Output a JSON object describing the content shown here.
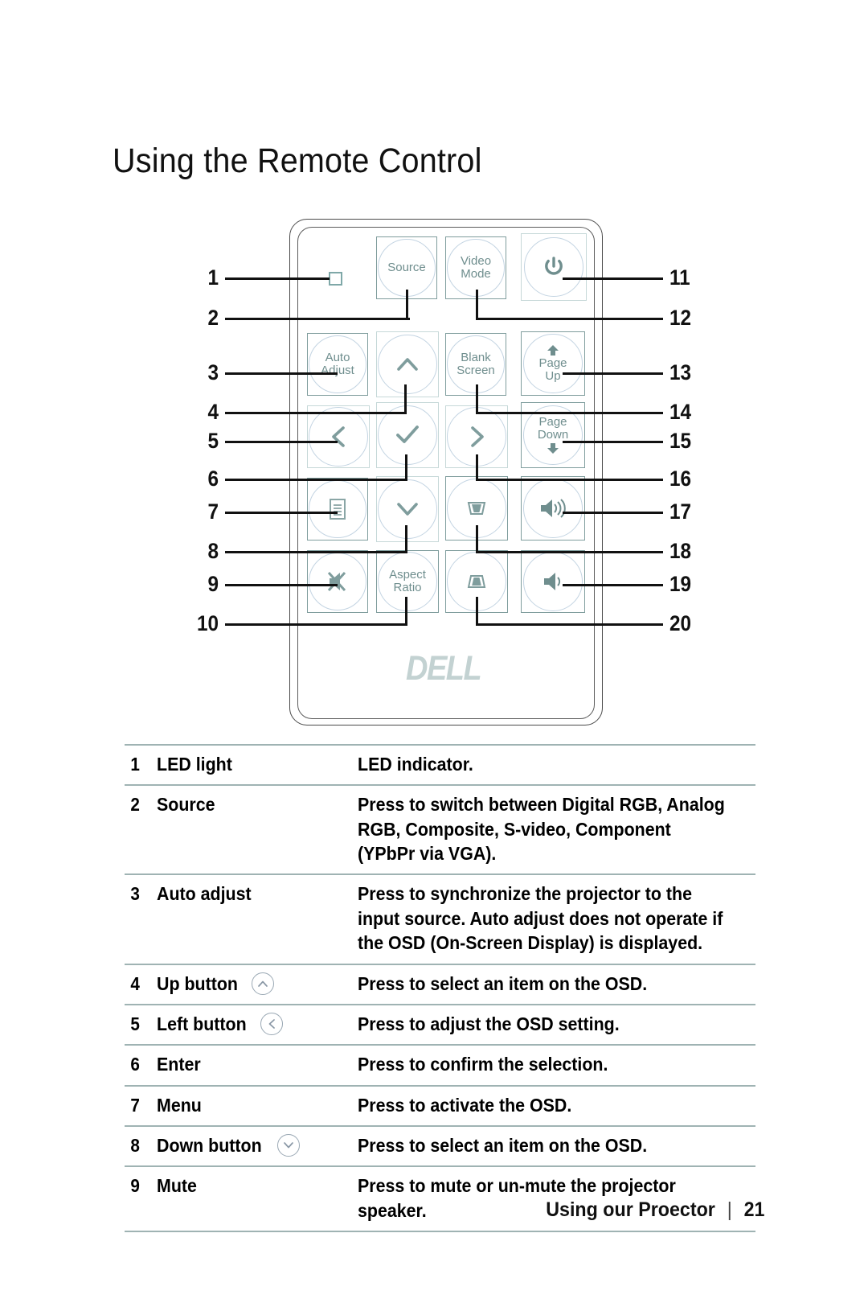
{
  "page_title": "Using the Remote Control",
  "remote": {
    "logo_text": "DELL",
    "led_indicator_name": "led-light",
    "buttons": [
      {
        "id": "source",
        "label": "Source",
        "icon": ""
      },
      {
        "id": "video-mode",
        "label": "Video\nMode",
        "icon": ""
      },
      {
        "id": "power",
        "label": "",
        "icon": "power-icon"
      },
      {
        "id": "auto-adjust",
        "label": "Auto\nAdjust",
        "icon": ""
      },
      {
        "id": "up",
        "label": "",
        "icon": "chevron-up-icon"
      },
      {
        "id": "blank-screen",
        "label": "Blank\nScreen",
        "icon": ""
      },
      {
        "id": "page-up",
        "label": "Page\nUp",
        "icon": "arrow-up-solid-icon"
      },
      {
        "id": "left",
        "label": "",
        "icon": "chevron-left-icon"
      },
      {
        "id": "enter",
        "label": "",
        "icon": "check-icon"
      },
      {
        "id": "right",
        "label": "",
        "icon": "chevron-right-icon"
      },
      {
        "id": "page-down",
        "label": "Page\nDown",
        "icon": "arrow-down-solid-icon"
      },
      {
        "id": "menu",
        "label": "",
        "icon": "menu-list-icon"
      },
      {
        "id": "down",
        "label": "",
        "icon": "chevron-down-icon"
      },
      {
        "id": "keystone-up",
        "label": "",
        "icon": "keystone-up-icon"
      },
      {
        "id": "volume-up",
        "label": "",
        "icon": "volume-up-icon"
      },
      {
        "id": "mute",
        "label": "",
        "icon": "speaker-mute-icon"
      },
      {
        "id": "aspect-ratio",
        "label": "Aspect\nRatio",
        "icon": ""
      },
      {
        "id": "keystone-down",
        "label": "",
        "icon": "keystone-down-icon"
      },
      {
        "id": "volume-down",
        "label": "",
        "icon": "volume-down-icon"
      }
    ],
    "callouts_left": [
      "1",
      "2",
      "3",
      "4",
      "5",
      "6",
      "7",
      "8",
      "9",
      "10"
    ],
    "callouts_right": [
      "11",
      "12",
      "13",
      "14",
      "15",
      "16",
      "17",
      "18",
      "19",
      "20"
    ]
  },
  "table": {
    "rows": [
      {
        "num": "1",
        "name": "LED light",
        "icon": "",
        "desc": "LED indicator."
      },
      {
        "num": "2",
        "name": "Source",
        "icon": "",
        "desc": "Press to switch between Digital RGB, Analog RGB, Composite, S-video, Component (YPbPr via VGA)."
      },
      {
        "num": "3",
        "name": "Auto adjust",
        "icon": "",
        "desc": "Press to synchronize the projector to the input source. Auto adjust does not operate if the OSD (On-Screen Display) is displayed."
      },
      {
        "num": "4",
        "name": "Up button",
        "icon": "chevron-up-icon",
        "desc": "Press to select an item on the OSD."
      },
      {
        "num": "5",
        "name": "Left button",
        "icon": "chevron-left-icon",
        "desc": "Press to adjust the OSD setting."
      },
      {
        "num": "6",
        "name": "Enter",
        "icon": "",
        "desc": "Press to confirm the selection."
      },
      {
        "num": "7",
        "name": "Menu",
        "icon": "",
        "desc": "Press to activate the OSD."
      },
      {
        "num": "8",
        "name": "Down button",
        "icon": "chevron-down-icon",
        "desc": "Press to select an item on the OSD."
      },
      {
        "num": "9",
        "name": "Mute",
        "icon": "",
        "desc": "Press to mute or un-mute the projector speaker."
      }
    ]
  },
  "footer": {
    "section": "Using our Proector",
    "separator": "|",
    "page_number": "21"
  },
  "colors": {
    "button_outline": "#7f9d9d",
    "button_outline_faint": "#c6d8d8",
    "circle_outline": "#c3d4e2",
    "icon": "#6f8e8e",
    "led_outline": "#7fa8a8",
    "rule": "#9fb3b3",
    "logo": "#c3d2d2",
    "text": "#000000"
  }
}
